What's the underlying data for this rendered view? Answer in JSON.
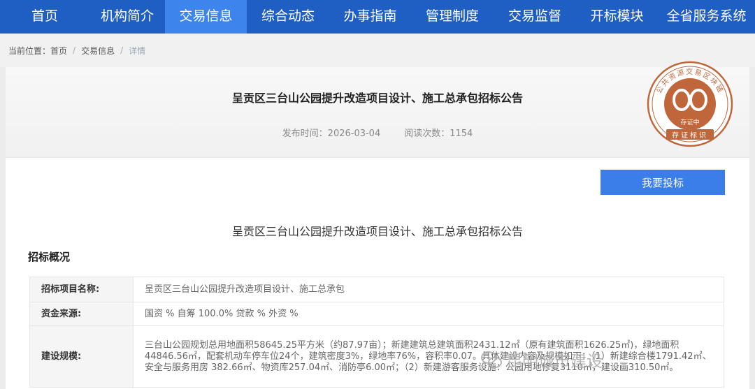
{
  "nav": {
    "items": [
      "首页",
      "机构简介",
      "交易信息",
      "综合动态",
      "办事指南",
      "管理制度",
      "交易监督",
      "开标模块",
      "全省服务系统"
    ],
    "active_index": 2
  },
  "breadcrumb": {
    "prefix": "当前位置：",
    "items": [
      "首页",
      "交易信息",
      "详情"
    ],
    "separator": "/"
  },
  "article": {
    "title": "呈贡区三台山公园提升改造项目设计、施工总承包招标公告",
    "publish_time": "发布时间：2026-03-04",
    "read_count": "阅读次数：1154",
    "bid_button": "我要投标",
    "subtitle": "呈贡区三台山公园提升改造项目设计、施工总承包招标公告",
    "section_title": "招标概况"
  },
  "seal": {
    "ring_text": "公共资源交易区块链",
    "status": "存证中",
    "bottom_text": "存证标识",
    "color": "#c0663b"
  },
  "table": {
    "rows": [
      {
        "label": "招标项目名称:",
        "value": "呈贡区三台山公园提升改造项目设计、施工总承包"
      },
      {
        "label": "资金来源:",
        "value": "国资 % 自筹 100.0% 贷款 % 外资 %"
      },
      {
        "label": "建设规模:",
        "value": "三台山公园规划总用地面积58645.25平方米（约87.97亩）；新建建筑总建筑面积2431.12㎡（原有建筑面积1626.25㎡)，绿地面积44846.56㎡，配套机动车停车位24个，建筑密度3%，绿地率76%，容积率0.07。具体建设内容及规模如下：（1）新建综合楼1791.42㎡、安全与服务用房 382.66㎡、物资库257.04㎡、消防亭6.00㎡；（2）新建游客服务设施：公园用地修复3110㎡，建设画310.50㎡。"
      }
    ]
  },
  "watermark": {
    "text": "昆明城市建设"
  },
  "colors": {
    "nav_bg": "#1f5fc4",
    "nav_active": "#3d84ec",
    "button": "#3b7de9"
  }
}
